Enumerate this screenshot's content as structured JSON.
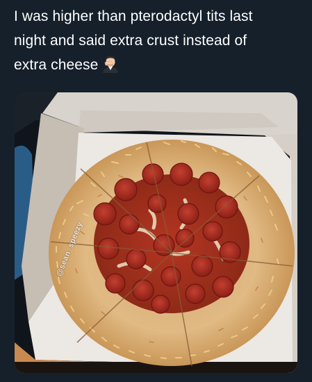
{
  "tweet": {
    "line1": "I was higher than pterodactyl tits last",
    "line2": "night and said extra crust instead of",
    "line3": "extra cheese",
    "emoji_icon": "man-facepalming-emoji"
  },
  "media": {
    "watermark": "@sean_speezy"
  },
  "colors": {
    "background": "#15202b",
    "text": "#ffffff",
    "crust": "#e2ba82",
    "sauce": "#b0301c",
    "pepperoni": "#a8281f",
    "box": "#ece8e3"
  }
}
